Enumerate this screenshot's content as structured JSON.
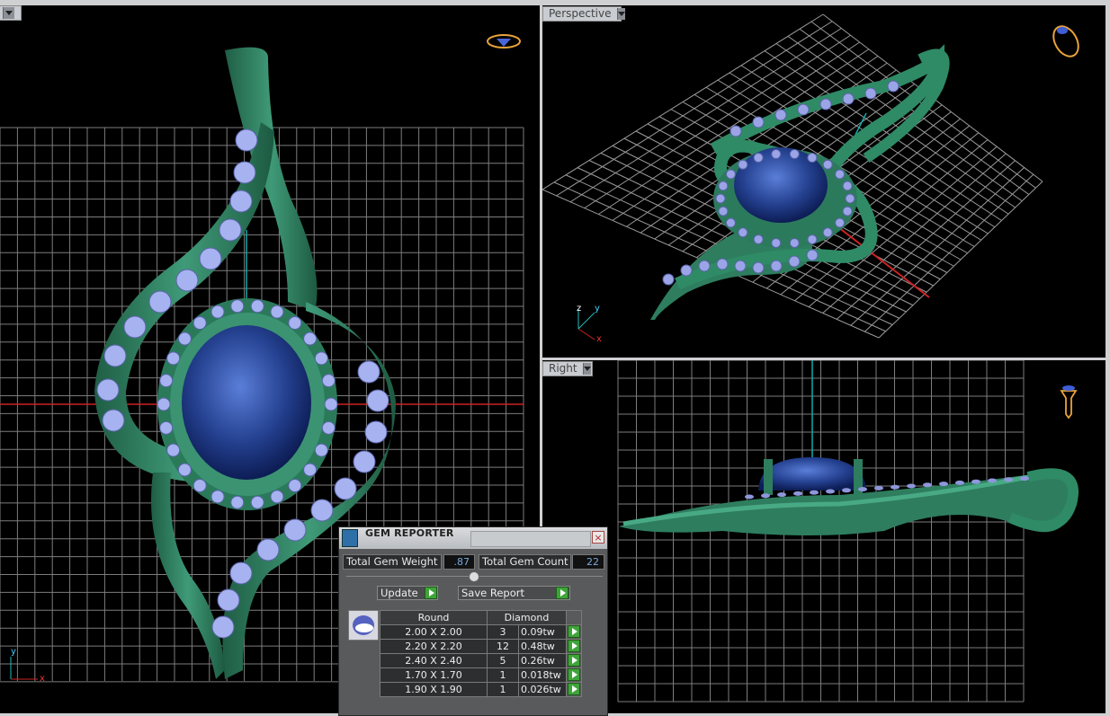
{
  "viewports": {
    "top": {
      "label": ""
    },
    "perspective": {
      "label": "Perspective",
      "axes": [
        "z",
        "y",
        "x"
      ]
    },
    "right": {
      "label": "Right"
    },
    "front_axes": [
      "y",
      "x"
    ]
  },
  "gem_reporter": {
    "title": "GEM REPORTER",
    "close": "×",
    "total_weight_label": "Total Gem Weight",
    "total_weight_value": ".87",
    "total_count_label": "Total Gem Count",
    "total_count_value": "22",
    "update_label": "Update",
    "save_label": "Save Report",
    "table": {
      "headers": [
        "Round",
        "Diamond"
      ],
      "rows": [
        {
          "size": "2.00 X 2.00",
          "count": "3",
          "weight": "0.09tw"
        },
        {
          "size": "2.20 X 2.20",
          "count": "12",
          "weight": "0.48tw"
        },
        {
          "size": "2.40 X 2.40",
          "count": "5",
          "weight": "0.26tw"
        },
        {
          "size": "1.70 X 1.70",
          "count": "1",
          "weight": "0.018tw"
        },
        {
          "size": "1.90 X 1.90",
          "count": "1",
          "weight": "0.026tw"
        }
      ]
    }
  },
  "colors": {
    "metal": "#2e7d5f",
    "gem": "#2b4aa0",
    "stones": "#9aa4e6",
    "grid": "#8a8a8a",
    "accent": "#e8a33a"
  }
}
